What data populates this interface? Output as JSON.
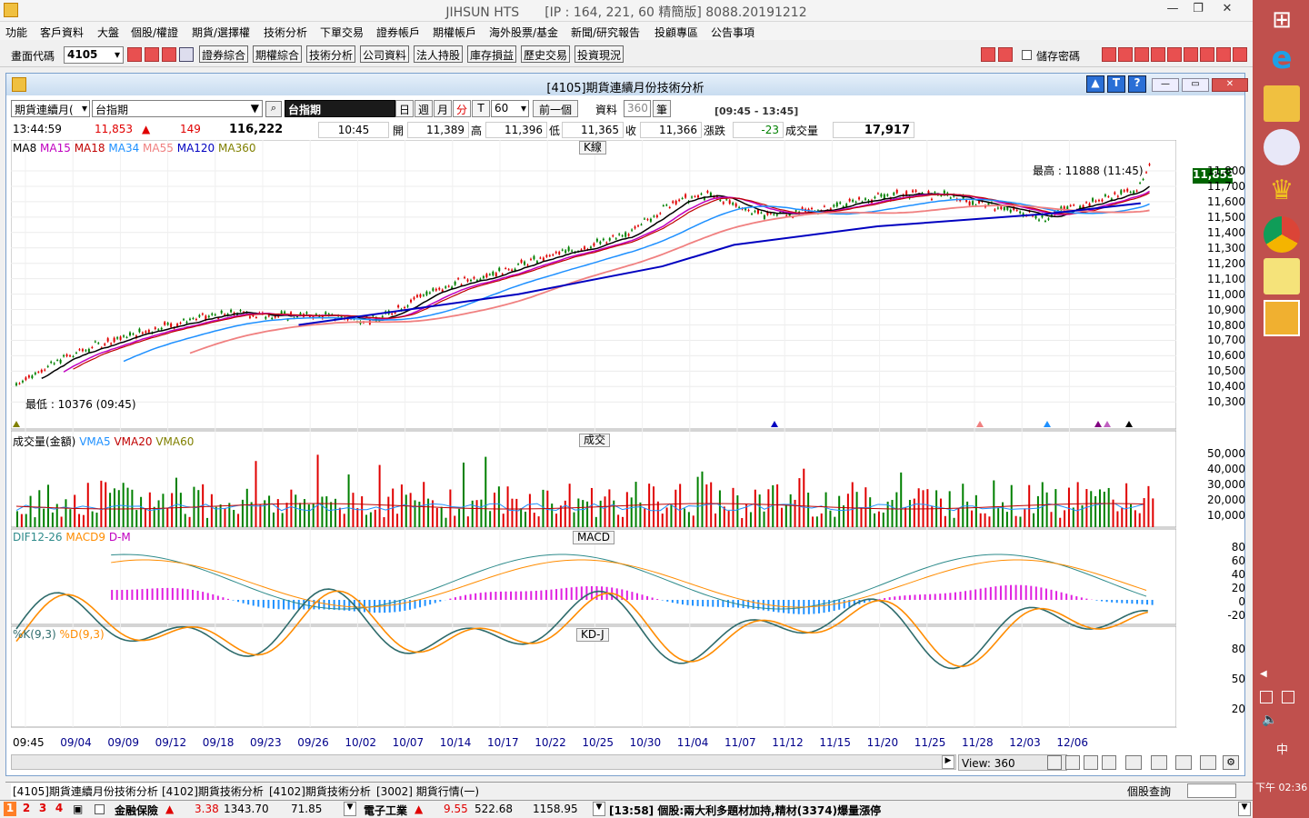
{
  "window": {
    "title": "JIHSUN HTS　　[IP : 164, 221, 60 精簡版] 8088.20191212"
  },
  "menu": [
    "功能",
    "客戶資料",
    "大盤",
    "個股/權證",
    "期貨/選擇權",
    "技術分析",
    "下單交易",
    "證券帳戶",
    "期權帳戶",
    "海外股票/基金",
    "新聞/研究報告",
    "投顧專區",
    "公告事項"
  ],
  "toolbar": {
    "code_label": "畫面代碼",
    "code_value": "4105",
    "buttons": [
      "證券綜合",
      "期權綜合",
      "技術分析",
      "公司資料",
      "法人持股",
      "庫存損益",
      "歷史交易",
      "投資現況"
    ],
    "save_pw": "儲存密碼"
  },
  "inner": {
    "title": "[4105]期貨連續月份技術分析"
  },
  "controls": {
    "contract_type": "期貨連續月(",
    "symbol": "台指期",
    "symbol_dark": "台指期",
    "periods": [
      "日",
      "週",
      "月",
      "分",
      "T"
    ],
    "interval": "60",
    "prev": "前一個",
    "data_label": "資料",
    "data_count": "360",
    "count_unit": "筆",
    "time_range": "[09:45 - 13:45]"
  },
  "quote": {
    "time": "13:44:59",
    "price": "11,853",
    "change": "149",
    "volume_total": "116,222",
    "time2": "10:45",
    "open_label": "開",
    "open": "11,389",
    "high_label": "高",
    "high": "11,396",
    "low_label": "低",
    "low": "11,365",
    "close_label": "收",
    "close": "11,366",
    "chg_label": "漲跌",
    "chg": "-23",
    "vol_label": "成交量",
    "vol": "17,917"
  },
  "panels": {
    "kline": {
      "title": "K線",
      "legend": [
        {
          "t": "MA8",
          "c": "#000000"
        },
        {
          "t": "MA15",
          "c": "#c000c0"
        },
        {
          "t": "MA18",
          "c": "#c00000"
        },
        {
          "t": "MA34",
          "c": "#1e90ff"
        },
        {
          "t": "MA55",
          "c": "#f08080"
        },
        {
          "t": "MA120",
          "c": "#0000c0"
        },
        {
          "t": "MA360",
          "c": "#808000"
        }
      ],
      "hi_note": "最高 : 11888 (11:45)",
      "lo_note": "最低 : 10376 (09:45)",
      "last_price": "11,853",
      "yticks": [
        "11,800",
        "11,700",
        "11,600",
        "11,500",
        "11,400",
        "11,300",
        "11,200",
        "11,100",
        "11,000",
        "10,900",
        "10,800",
        "10,700",
        "10,600",
        "10,500",
        "10,400",
        "10,300"
      ]
    },
    "volume": {
      "title": "成交",
      "legend": [
        {
          "t": "成交量(金額)",
          "c": "#000000"
        },
        {
          "t": "VMA5",
          "c": "#1e90ff"
        },
        {
          "t": "VMA20",
          "c": "#c00000"
        },
        {
          "t": "VMA60",
          "c": "#808000"
        }
      ],
      "yticks": [
        "50,000",
        "40,000",
        "30,000",
        "20,000",
        "10,000"
      ]
    },
    "macd": {
      "title": "MACD",
      "legend": [
        {
          "t": "DIF12-26",
          "c": "#2e8b8b"
        },
        {
          "t": "MACD9",
          "c": "#ff8c00"
        },
        {
          "t": "D-M",
          "c": "#c000c0"
        }
      ],
      "yticks": [
        "80",
        "60",
        "40",
        "20",
        "0",
        "-20"
      ]
    },
    "kdj": {
      "title": "KD-J",
      "legend": [
        {
          "t": "%K(9,3)",
          "c": "#2e6b6b"
        },
        {
          "t": "%D(9,3)",
          "c": "#ff8c00"
        }
      ],
      "yticks": [
        "80",
        "50",
        "20"
      ]
    }
  },
  "xaxis": [
    "09:45",
    "09/04",
    "09/09",
    "09/12",
    "09/18",
    "09/23",
    "09/26",
    "10/02",
    "10/07",
    "10/14",
    "10/17",
    "10/22",
    "10/25",
    "10/30",
    "11/04",
    "11/07",
    "11/12",
    "11/15",
    "11/20",
    "11/25",
    "11/28",
    "12/03",
    "12/06"
  ],
  "bottom": {
    "view_label": "View:",
    "view_value": "360"
  },
  "tabs": [
    "[4105]期貨連續月份技術分析",
    "[4102]期貨技術分析",
    "[4102]期貨技術分析",
    "[3002] 期貨行情(一)"
  ],
  "status": {
    "pages": [
      "1",
      "2",
      "3",
      "4"
    ],
    "item1": "金融保險",
    "v1a": "3.38",
    "v1b": "1343.70",
    "v1c": "71.85",
    "item2": "電子工業",
    "v2a": "9.55",
    "v2b": "522.68",
    "v2c": "1158.95",
    "news": "[13:58] 個股:兩大利多題材加持,精材(3374)爆量漲停",
    "right_label": "個股查詢"
  },
  "taskbar": {
    "clock": "下午 02:36",
    "ime": "中"
  },
  "colors": {
    "up": "#e00000",
    "down": "#008000",
    "bg_chart": "#ffffff",
    "grid": "#e0e0e0"
  }
}
